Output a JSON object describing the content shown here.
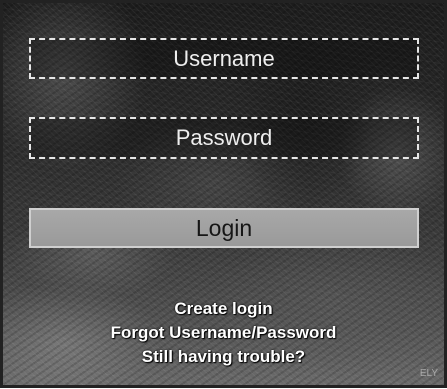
{
  "login_form": {
    "username": {
      "placeholder": "Username",
      "value": ""
    },
    "password": {
      "placeholder": "Password",
      "value": ""
    },
    "login_button_label": "Login"
  },
  "links": {
    "create_login": "Create login",
    "forgot": "Forgot Username/Password",
    "trouble": "Still having trouble?"
  },
  "corner_badge": "ELY",
  "colors": {
    "field_border": "#e6e6e6",
    "button_bg": "#a8a8a8",
    "link_text": "#ffffff"
  }
}
